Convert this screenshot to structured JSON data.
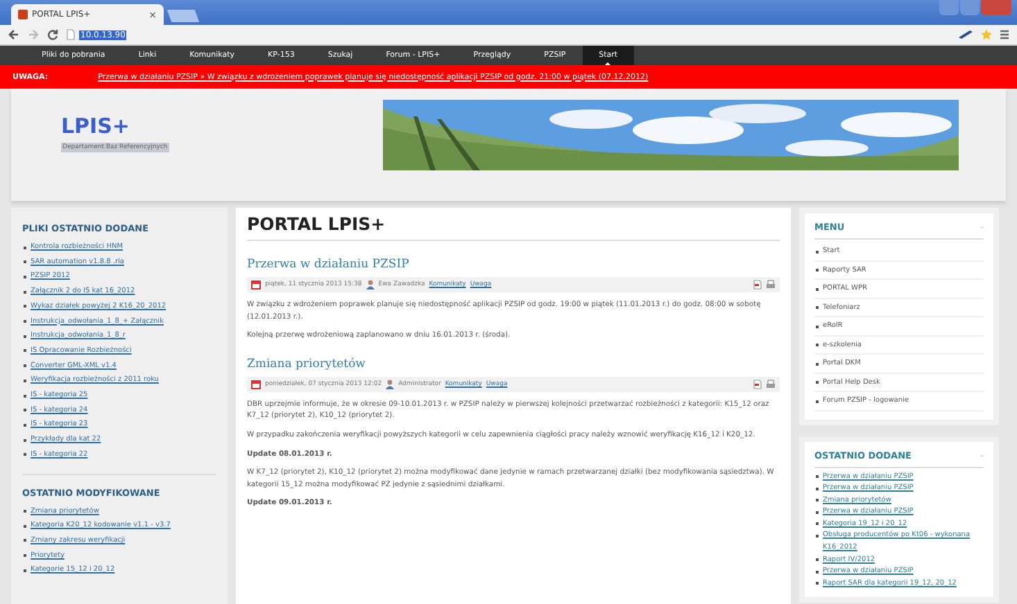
{
  "browser": {
    "tab_title": "PORTAL LPIS+",
    "tab_close": "×",
    "url": "10.0.13.90"
  },
  "nav": [
    {
      "label": "Pliki do pobrania",
      "selected": false
    },
    {
      "label": "Linki",
      "selected": false
    },
    {
      "label": "Komunikaty",
      "selected": false
    },
    {
      "label": "KP-153",
      "selected": false
    },
    {
      "label": "Szukaj",
      "selected": false
    },
    {
      "label": "Forum - LPIS+",
      "selected": false
    },
    {
      "label": "Przeglądy",
      "selected": false
    },
    {
      "label": "PZSIP",
      "selected": false
    },
    {
      "label": "Start",
      "selected": true
    }
  ],
  "alert": {
    "label": "UWAGA:",
    "text": "Przerwa w działaniu PZSIP » W związku z wdrożeniem poprawek planuje się niedostępność aplikacji PZSIP od godz. 21:00 w piątek (07.12.2012)"
  },
  "header": {
    "logo": "LPIS+",
    "subtitle": "Departament Baz Referencyjnych"
  },
  "left": [
    {
      "title": "PLIKI OSTATNIO DODANE",
      "items": [
        "Kontrola rozbieżności HNM",
        "SAR automation v1.8.8 .rla",
        "PZSIP 2012",
        "Załącznik 2 do IS kat 16_2012",
        "Wykaz działek powyżej 2 K16_20_2012",
        "Instrukcja_odwołania_1_8_+ Załącznik",
        "Instrukcja_odwołania_1_8_r",
        "IS Opracowanie Rozbieżności",
        "Converter GML-XML v1.4",
        "Weryfikacja rozbieżności z 2011 roku",
        "IS - kategoria 25",
        "IS - kategoria 24",
        "IS - kategoria 23",
        "Przykłady dla kat 22",
        "IS - kategoria 22"
      ]
    },
    {
      "title": "OSTATNIO MODYFIKOWANE",
      "items": [
        "Zmiana priorytetów",
        "Kategoria K20_12 kodowanie v1.1 - v3.7",
        "Zmiany zakresu weryfikacji",
        "Priorytety",
        "Kategorie 15_12 i 20_12"
      ]
    }
  ],
  "main": {
    "title": "PORTAL LPIS+",
    "articles": [
      {
        "title": "Przerwa w działaniu PZSIP",
        "date": "piątek, 11 stycznia 2013 15:38",
        "author": "Ewa Zawadzka",
        "categories": [
          "Komunikaty",
          "Uwaga"
        ],
        "paragraphs": [
          {
            "text": "W związku z wdrożeniem poprawek planuje się niedostępność aplikacji PZSIP od godz. 19:00 w piątek (11.01.2013 r.) do godz. 08:00 w sobotę (12.01.2013 r.).",
            "bold": false
          },
          {
            "text": "Kolejną przerwę wdrożeniową zaplanowano w dniu 16.01.2013 r. (środa).",
            "bold": false
          }
        ]
      },
      {
        "title": "Zmiana priorytetów",
        "date": "poniedziałek, 07 stycznia 2013 12:02",
        "author": "Administrator",
        "categories": [
          "Komunikaty",
          "Uwaga"
        ],
        "paragraphs": [
          {
            "text": "DBR uprzejmie informuje, że w okresie 09-10.01.2013 r. w PZSIP należy w pierwszej kolejności przetwarzać rozbieżności z kategorii: K15_12 oraz K7_12 (priorytet 2), K10_12 (priorytet 2).",
            "bold": false
          },
          {
            "text": "W przypadku zakończenia weryfikacji powyższych kategorii w celu zapewnienia ciągłości pracy należy wznowić weryfikację K16_12 i K20_12.",
            "bold": false
          },
          {
            "text": "Update 08.01.2013 r.",
            "bold": true
          },
          {
            "text": "W K7_12 (priorytet 2), K10_12 (priorytet 2) można modyfikować dane jedynie w ramach przetwarzanej działki (bez modyfikowania sąsiedztwa). W kategorii 15_12 można modyfikować PZ jedynie z sąsiednimi działkami.",
            "bold": false
          },
          {
            "text": "Update 09.01.2013 r.",
            "bold": true
          }
        ]
      }
    ]
  },
  "right": [
    {
      "title": "MENU",
      "toggle": "-",
      "kind": "menu",
      "items": [
        "Start",
        "Raporty SAR",
        "PORTAL WPR",
        "Telefoniarz",
        "eRolR",
        "e-szkolenia",
        "Portal DKM",
        "Portal Help Desk",
        "Forum PZSIP - logowanie"
      ]
    },
    {
      "title": "OSTATNIO DODANE",
      "toggle": "-",
      "kind": "links",
      "items": [
        "Przerwa w działaniu PZSIP",
        "Przerwa w działaniu PZSIP",
        "Zmiana priorytetów",
        "Przerwa w działaniu PZSIP",
        "Kategoria 19_12 i 20_12",
        "Obsługa producentów po Kt06 - wykonana K16_2012",
        "Raport IV/2012",
        "Przerwa w działaniu PZSIP",
        "Raport SAR dla kategorii 19_12, 20_12"
      ]
    }
  ]
}
